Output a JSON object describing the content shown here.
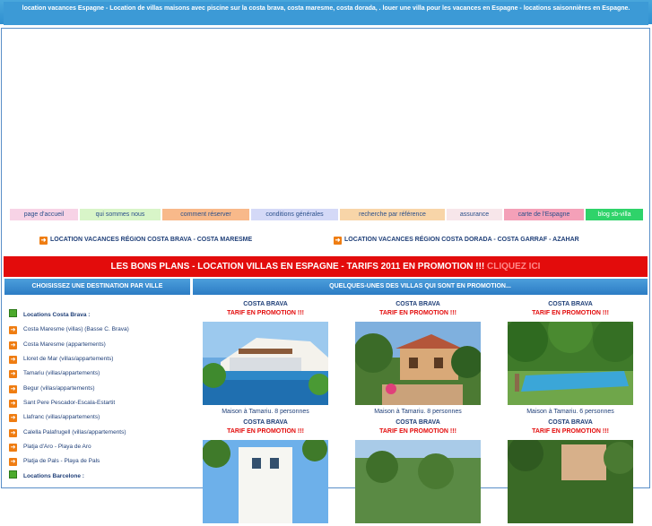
{
  "header": {
    "title": "location vacances Espagne - Location de villas maisons avec piscine sur la costa brava, costa maresme, costa dorada, . louer une villa pour les vacances en Espagne - locations saisonnières en Espagne."
  },
  "nav": {
    "items": [
      {
        "label": "page d'accueil",
        "color": "#f7d3e6",
        "text": "#2a4f8a"
      },
      {
        "label": "qui sommes nous",
        "color": "#d8f5c8",
        "text": "#2a4f8a"
      },
      {
        "label": "comment réserver",
        "color": "#f8b98a",
        "text": "#2a4f8a"
      },
      {
        "label": "conditions générales",
        "color": "#d4d9f7",
        "text": "#2a4f8a"
      },
      {
        "label": "recherche par référence",
        "color": "#f8d5a8",
        "text": "#2a4f8a"
      },
      {
        "label": "assurance",
        "color": "#f7e6ea",
        "text": "#2a4f8a"
      },
      {
        "label": "carte de l'Espagne",
        "color": "#f4a0b8",
        "text": "#2a4f8a"
      },
      {
        "label": "blog sb-villa",
        "color": "#2fd36a",
        "text": "#ffffff"
      }
    ]
  },
  "regions": {
    "left": "LOCATION VACANCES RÉGION COSTA BRAVA - COSTA MARESME",
    "right": "LOCATION VACANCES RÉGION COSTA DORADA - COSTA GARRAF - AZAHAR"
  },
  "promo": {
    "text": "LES BONS PLANS - LOCATION VILLAS EN ESPAGNE - TARIFS 2011 EN PROMOTION !!! ",
    "click": "CLIQUEZ ICI"
  },
  "sidebar": {
    "heading": "CHOISISSEZ UNE DESTINATION PAR VILLE",
    "items": [
      {
        "label": "Locations Costa Brava :",
        "kind": "section"
      },
      {
        "label": "Costa Maresme (villas) (Basse C. Brava)",
        "kind": "link"
      },
      {
        "label": "Costa Maresme (appartements)",
        "kind": "link"
      },
      {
        "label": "Lloret de Mar (villas/appartements)",
        "kind": "link"
      },
      {
        "label": "Tamariu (villas/appartements)",
        "kind": "link"
      },
      {
        "label": "Begur (villas/appartements)",
        "kind": "link"
      },
      {
        "label": "Sant Pere Pescador-Escala-Estartit",
        "kind": "link"
      },
      {
        "label": "Llafranc (villas/appartements)",
        "kind": "link"
      },
      {
        "label": "Calella Palafrugell (villas/appartements)",
        "kind": "link"
      },
      {
        "label": "Platja d'Aro - Playa de Aro",
        "kind": "link"
      },
      {
        "label": "Platja de Pals - Playa de Pals",
        "kind": "link"
      },
      {
        "label": "Locations Barcelone :",
        "kind": "section"
      }
    ]
  },
  "main": {
    "heading": "QUELQUES-UNES DES VILLAS QUI SONT EN PROMOTION...",
    "cards": [
      {
        "region": "COSTA BRAVA",
        "tarif": "TARIF EN PROMOTION !!!",
        "caption": "Maison à Tamariu. 8 personnes"
      },
      {
        "region": "COSTA BRAVA",
        "tarif": "TARIF EN PROMOTION !!!",
        "caption": "Maison à Tamariu. 8 personnes"
      },
      {
        "region": "COSTA BRAVA",
        "tarif": "TARIF EN PROMOTION !!!",
        "caption": "Maison à Tamariu. 6 personnes"
      },
      {
        "region": "COSTA BRAVA",
        "tarif": "TARIF EN PROMOTION !!!",
        "caption": ""
      },
      {
        "region": "COSTA BRAVA",
        "tarif": "TARIF EN PROMOTION !!!",
        "caption": ""
      },
      {
        "region": "COSTA BRAVA",
        "tarif": "TARIF EN PROMOTION !!!",
        "caption": ""
      }
    ]
  },
  "colors": {
    "header_blue": "#3c9ad6",
    "promo_red": "#e30c0c",
    "link_blue": "#1f3f78",
    "arrow_orange": "#ef7d12",
    "bullet_green": "#4caa2c"
  }
}
